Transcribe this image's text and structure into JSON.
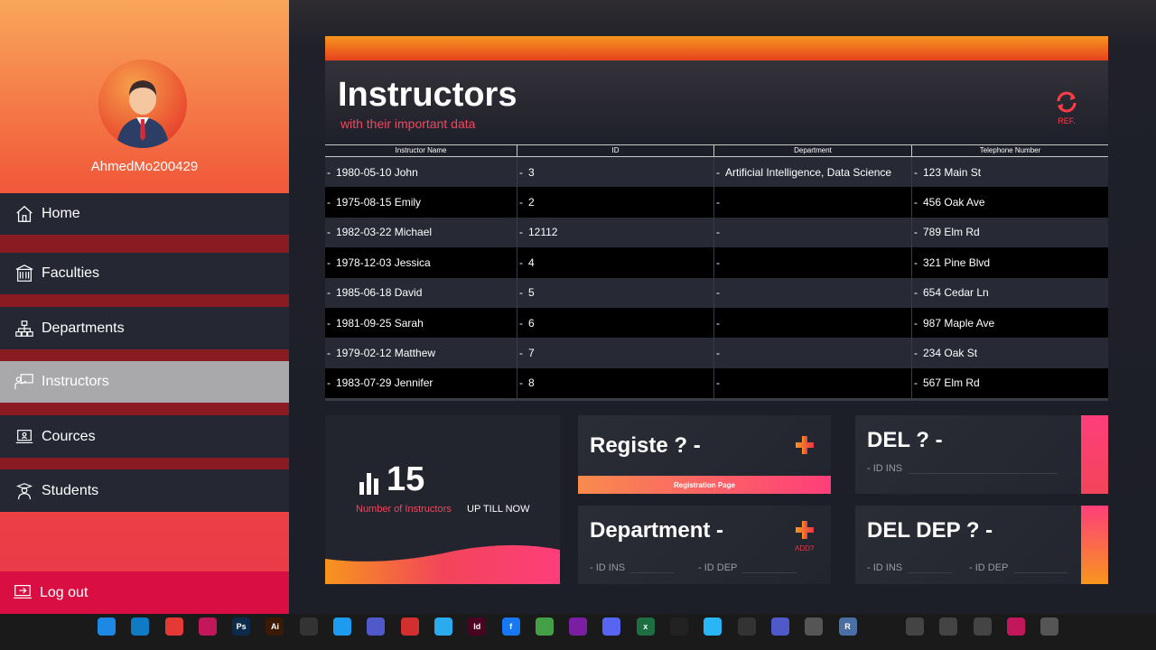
{
  "sidebar": {
    "username": "AhmedMo200429",
    "items": [
      {
        "label": "Home",
        "icon": "home-icon"
      },
      {
        "label": "Faculties",
        "icon": "building-icon"
      },
      {
        "label": "Departments",
        "icon": "hierarchy-icon"
      },
      {
        "label": "Instructors",
        "icon": "teacher-icon"
      },
      {
        "label": "Cources",
        "icon": "laptop-icon"
      },
      {
        "label": "Students",
        "icon": "student-icon"
      }
    ],
    "active": "Instructors",
    "logout": "Log out"
  },
  "header": {
    "title": "Instructors",
    "subtitle": "with their important data",
    "refresh_label": "REF."
  },
  "table": {
    "columns": [
      "Instructor Name",
      "ID",
      "Department",
      "Telephone Number"
    ],
    "rows": [
      {
        "name": "1980-05-10 John",
        "id": "3",
        "department": "Artificial Intelligence, Data Science",
        "phone": "123 Main St"
      },
      {
        "name": "1975-08-15 Emily",
        "id": "2",
        "department": "",
        "phone": "456 Oak Ave"
      },
      {
        "name": "1982-03-22 Michael",
        "id": "12112",
        "department": "",
        "phone": "789 Elm Rd"
      },
      {
        "name": "1978-12-03 Jessica",
        "id": "4",
        "department": "",
        "phone": "321 Pine Blvd"
      },
      {
        "name": "1985-06-18 David",
        "id": "5",
        "department": "",
        "phone": "654 Cedar Ln"
      },
      {
        "name": "1981-09-25 Sarah",
        "id": "6",
        "department": "",
        "phone": "987 Maple Ave"
      },
      {
        "name": "1979-02-12 Matthew",
        "id": "7",
        "department": "",
        "phone": "234 Oak St"
      },
      {
        "name": "1983-07-29 Jennifer",
        "id": "8",
        "department": "",
        "phone": "567 Elm Rd"
      }
    ]
  },
  "stats": {
    "count": "15",
    "label": "Number of Instructors",
    "suffix": "UP TILL NOW"
  },
  "register": {
    "title": "Registe ?  -",
    "button": "Registration Page"
  },
  "department": {
    "title": "Department -",
    "add_label": "ADD?",
    "id_ins_label": "-  ID INS",
    "id_dep_label": "-  ID DEP"
  },
  "delete": {
    "title": "DEL ? -",
    "id_ins_label": "-  ID INS"
  },
  "delete_dep": {
    "title": "DEL DEP ? -",
    "id_ins_label": "-  ID INS",
    "id_dep_label": "-  ID DEP"
  },
  "colors": {
    "accent_red": "#e8384a",
    "accent_orange": "#f7951d",
    "sidebar_item": "#252833",
    "active_item": "#a9a9ab",
    "logout": "#d90f43"
  },
  "taskbar": {
    "icons": [
      {
        "name": "desktop-icon",
        "label": "",
        "color": "#1e88e5"
      },
      {
        "name": "edge-icon",
        "label": "",
        "color": "#0f7bc4"
      },
      {
        "name": "chrome-icon",
        "label": "",
        "color": "#e53935"
      },
      {
        "name": "app-icon",
        "label": "",
        "color": "#c2185b"
      },
      {
        "name": "photoshop-icon",
        "label": "Ps",
        "color": "#0c2b4a"
      },
      {
        "name": "illustrator-icon",
        "label": "Ai",
        "color": "#3a1a05"
      },
      {
        "name": "audio-icon",
        "label": "",
        "color": "#333333"
      },
      {
        "name": "twitter-icon",
        "label": "",
        "color": "#1d9bf0"
      },
      {
        "name": "teams-icon",
        "label": "",
        "color": "#5059c9"
      },
      {
        "name": "pdf-icon",
        "label": "",
        "color": "#d32f2f"
      },
      {
        "name": "telegram-icon",
        "label": "",
        "color": "#2aabee"
      },
      {
        "name": "indesign-icon",
        "label": "Id",
        "color": "#49021f"
      },
      {
        "name": "facebook-icon",
        "label": "f",
        "color": "#1877f2"
      },
      {
        "name": "send-icon",
        "label": "",
        "color": "#43a047"
      },
      {
        "name": "calculator-icon",
        "label": "",
        "color": "#7b1fa2"
      },
      {
        "name": "discord-icon",
        "label": "",
        "color": "#5865f2"
      },
      {
        "name": "excel-icon",
        "label": "x",
        "color": "#1d6f42"
      },
      {
        "name": "tiktok-icon",
        "label": "",
        "color": "#222222"
      },
      {
        "name": "maps-icon",
        "label": "",
        "color": "#29b6f6"
      },
      {
        "name": "audio2-icon",
        "label": "",
        "color": "#333333"
      },
      {
        "name": "teams2-icon",
        "label": "",
        "color": "#5059c9"
      },
      {
        "name": "globe-icon",
        "label": "",
        "color": "#555555"
      },
      {
        "name": "r-icon",
        "label": "R",
        "color": "#4a6fa5"
      },
      {
        "name": "separator-icon",
        "label": "",
        "color": "#1a1a1a"
      },
      {
        "name": "monitor-icon",
        "label": "",
        "color": "#444444"
      },
      {
        "name": "network-icon",
        "label": "",
        "color": "#444444"
      },
      {
        "name": "files-icon",
        "label": "",
        "color": "#444444"
      },
      {
        "name": "whatsapp-icon",
        "label": "",
        "color": "#c2185b"
      },
      {
        "name": "screen-icon",
        "label": "",
        "color": "#555555"
      }
    ]
  }
}
